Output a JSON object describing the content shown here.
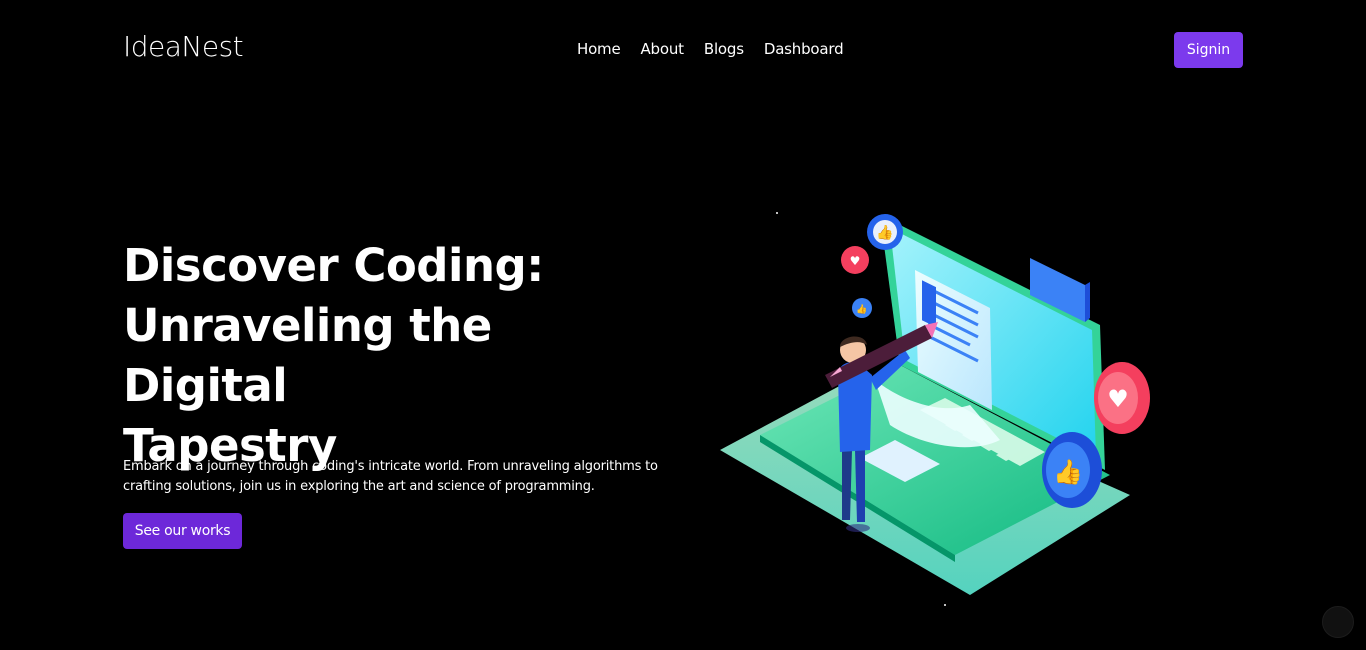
{
  "header": {
    "logo": "IdeaNest",
    "nav": [
      "Home",
      "About",
      "Blogs",
      "Dashboard"
    ],
    "signin_label": "Signin"
  },
  "hero": {
    "title_lines": [
      "Discover Coding:",
      "Unraveling the Digital",
      "Tapestry"
    ],
    "description": "Embark on a journey through coding's intricate world. From unraveling algorithms to crafting solutions, join us in exploring the art and science of programming.",
    "cta_label": "See our works"
  },
  "colors": {
    "background": "#000000",
    "accent": "#7c3aed",
    "cta": "#6d28d9",
    "text": "#ffffff"
  }
}
